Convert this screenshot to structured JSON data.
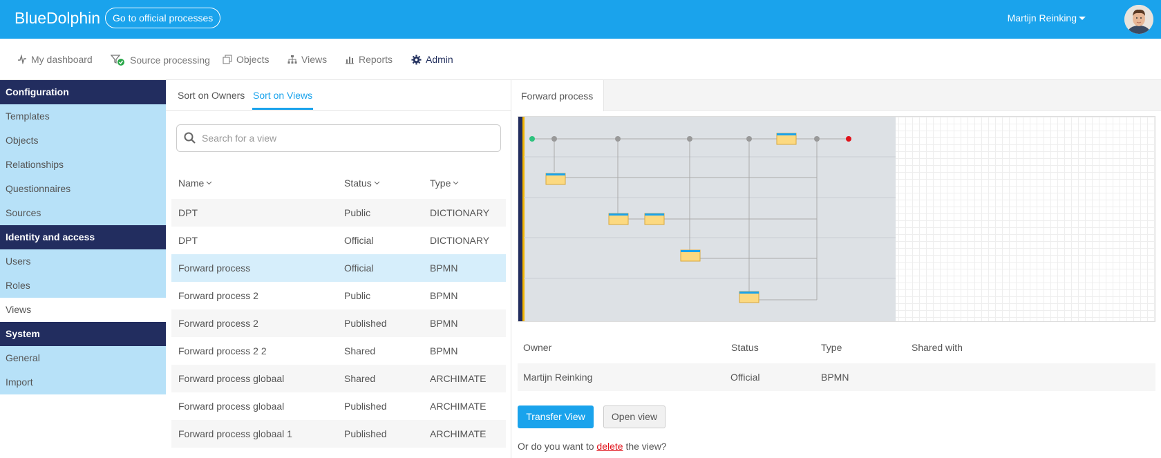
{
  "header": {
    "brand": "BlueDolphin",
    "official_button": "Go to official processes",
    "user_name": "Martijn Reinking"
  },
  "nav": [
    {
      "label": "My dashboard",
      "icon": "pulse-icon"
    },
    {
      "label": "Source processing",
      "icon": "filter-check-icon"
    },
    {
      "label": "Objects",
      "icon": "objects-icon"
    },
    {
      "label": "Views",
      "icon": "hierarchy-icon"
    },
    {
      "label": "Reports",
      "icon": "bar-chart-icon"
    },
    {
      "label": "Admin",
      "icon": "gear-icon"
    }
  ],
  "sidebar": {
    "configuration": {
      "heading": "Configuration",
      "items": [
        "Templates",
        "Objects",
        "Relationships",
        "Questionnaires",
        "Sources"
      ]
    },
    "identity": {
      "heading": "Identity and access",
      "items": [
        "Users",
        "Roles",
        "Views"
      ]
    },
    "system": {
      "heading": "System",
      "items": [
        "General",
        "Import"
      ]
    },
    "active_item": "Views"
  },
  "list": {
    "tabs": [
      "Sort on Owners",
      "Sort on Views"
    ],
    "active_tab": "Sort on Views",
    "search_placeholder": "Search for a view",
    "columns": {
      "name": "Name",
      "status": "Status",
      "type": "Type"
    },
    "rows": [
      {
        "name": "DPT",
        "status": "Public",
        "type": "DICTIONARY"
      },
      {
        "name": "DPT",
        "status": "Official",
        "type": "DICTIONARY"
      },
      {
        "name": "Forward process",
        "status": "Official",
        "type": "BPMN"
      },
      {
        "name": "Forward process 2",
        "status": "Public",
        "type": "BPMN"
      },
      {
        "name": "Forward process 2",
        "status": "Published",
        "type": "BPMN"
      },
      {
        "name": "Forward process 2 2",
        "status": "Shared",
        "type": "BPMN"
      },
      {
        "name": "Forward process globaal",
        "status": "Shared",
        "type": "ARCHIMATE"
      },
      {
        "name": "Forward process globaal",
        "status": "Published",
        "type": "ARCHIMATE"
      },
      {
        "name": "Forward process globaal 1",
        "status": "Published",
        "type": "ARCHIMATE"
      }
    ],
    "selected_row": 2
  },
  "detail": {
    "tab": "Forward process",
    "columns": {
      "owner": "Owner",
      "status": "Status",
      "type": "Type",
      "shared": "Shared with"
    },
    "row": {
      "owner": "Martijn Reinking",
      "status": "Official",
      "type": "BPMN",
      "shared": ""
    },
    "transfer_button": "Transfer View",
    "open_button": "Open view",
    "delete_prefix": "Or do you want to",
    "delete_link": "delete",
    "delete_suffix": "the view?"
  },
  "colors": {
    "header_blue": "#1aa3ec",
    "sidebar_dark": "#222d5f",
    "sidebar_light": "#b7e1f8",
    "selected_row": "#d6eefb",
    "delete_red": "#e0121a"
  }
}
